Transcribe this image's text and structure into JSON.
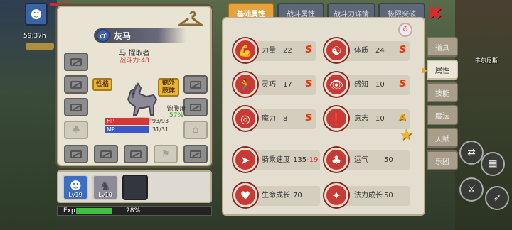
{
  "hud": {
    "time": "59:37h"
  },
  "pet": {
    "name": "灰马",
    "title": "马 擢取者",
    "power_label": "战斗力:48",
    "tag_personality": "性格",
    "tag_extra_body": "额外\n肢体",
    "satiety_label": "饱腹度",
    "satiety_value": "57%",
    "hp_label": "HP",
    "hp_value": "93/93",
    "hp_fraction": 1.0,
    "mp_label": "MP",
    "mp_value": "31/31",
    "mp_fraction": 1.0
  },
  "team": {
    "slots": [
      {
        "level": "Lv19"
      },
      {
        "level": "Lv10"
      },
      {
        "level": ""
      }
    ]
  },
  "exp": {
    "label": "Exp",
    "percent_text": "28%",
    "fraction": 0.28
  },
  "tabs": [
    {
      "label": "基础属性",
      "active": true
    },
    {
      "label": "战斗属性",
      "active": false
    },
    {
      "label": "战斗力详情",
      "active": false
    },
    {
      "label": "极限突破",
      "active": false
    }
  ],
  "attributes": {
    "rows": [
      {
        "name": "力量",
        "value": "22",
        "grade": "S",
        "icon": "muscle-icon"
      },
      {
        "name": "体质",
        "value": "24",
        "grade": "S",
        "icon": "body-icon"
      },
      {
        "name": "灵巧",
        "value": "17",
        "grade": "S",
        "icon": "runner-icon"
      },
      {
        "name": "感知",
        "value": "10",
        "grade": "S",
        "icon": "eye-icon"
      },
      {
        "name": "魔力",
        "value": "8",
        "grade": "S",
        "icon": "magic-orb-icon"
      },
      {
        "name": "意志",
        "value": "10",
        "grade": "A",
        "icon": "will-icon"
      },
      {
        "name": "骑乘速度",
        "value": "135",
        "value_red": "-19",
        "icon": "speed-icon"
      },
      {
        "name": "运气",
        "value": "50",
        "icon": "clover-icon"
      },
      {
        "name": "生命成长",
        "value": "70",
        "icon": "heart-growth-icon"
      },
      {
        "name": "法力成长",
        "value": "50",
        "icon": "mana-growth-icon"
      }
    ]
  },
  "side_menu": [
    {
      "label": "道具",
      "active": false
    },
    {
      "label": "属性",
      "active": true
    },
    {
      "label": "技能",
      "active": false
    },
    {
      "label": "魔法",
      "active": false
    },
    {
      "label": "天赋",
      "active": false
    },
    {
      "label": "乐团",
      "active": false
    }
  ],
  "npc_name": "韦尔尼斯",
  "colors": {
    "accent": "#e8a23a",
    "attr_icon": "#c93a34",
    "hp": "#c0302f",
    "mp": "#3a58c8",
    "exp": "#3fbf3f"
  }
}
